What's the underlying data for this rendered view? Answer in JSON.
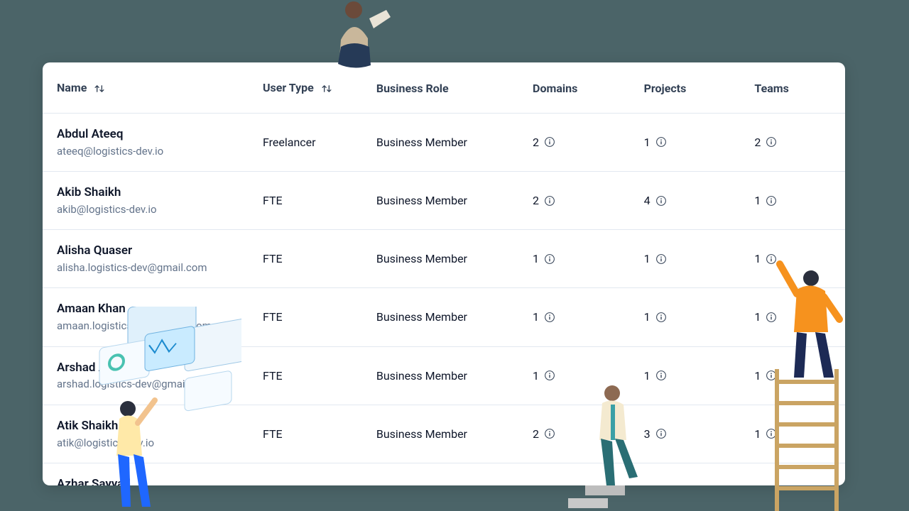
{
  "columns": {
    "name": "Name",
    "user_type": "User Type",
    "business_role": "Business Role",
    "domains": "Domains",
    "projects": "Projects",
    "teams": "Teams"
  },
  "rows": [
    {
      "name": "Abdul Ateeq",
      "email": "ateeq@logistics-dev.io",
      "user_type": "Freelancer",
      "business_role": "Business Member",
      "domains": "2",
      "projects": "1",
      "teams": "2"
    },
    {
      "name": "Akib Shaikh",
      "email": "akib@logistics-dev.io",
      "user_type": "FTE",
      "business_role": "Business Member",
      "domains": "2",
      "projects": "4",
      "teams": "1"
    },
    {
      "name": "Alisha Quaser",
      "email": "alisha.logistics-dev@gmail.com",
      "user_type": "FTE",
      "business_role": "Business Member",
      "domains": "1",
      "projects": "1",
      "teams": "1"
    },
    {
      "name": "Amaan Khan",
      "email": "amaan.logistics-dev@gmail.com",
      "user_type": "FTE",
      "business_role": "Business Member",
      "domains": "1",
      "projects": "1",
      "teams": "1"
    },
    {
      "name": "Arshad Ahmad",
      "email": "arshad.logistics-dev@gmail.com",
      "user_type": "FTE",
      "business_role": "Business Member",
      "domains": "1",
      "projects": "1",
      "teams": "1"
    },
    {
      "name": "Atik Shaikh",
      "email": "atik@logistics-dev.io",
      "user_type": "FTE",
      "business_role": "Business Member",
      "domains": "2",
      "projects": "3",
      "teams": "1"
    },
    {
      "name": "Azhar Sayyad",
      "email": "",
      "user_type": "",
      "business_role": "",
      "domains": "",
      "projects": "",
      "teams": ""
    }
  ]
}
